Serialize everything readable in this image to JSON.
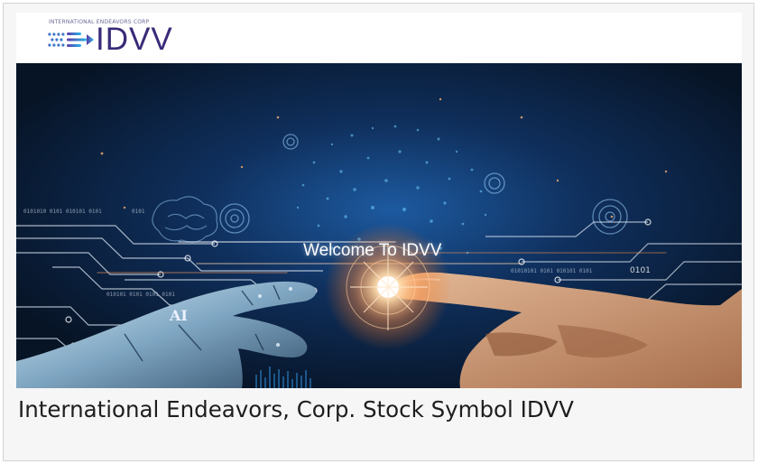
{
  "header": {
    "company_line": "INTERNATIONAL ENDEAVORS CORP",
    "logo_text": "IDVV",
    "logo_icon": "dotted-arrows-icon"
  },
  "hero": {
    "welcome_text": "Welcome To IDVV",
    "ai_label": "AI",
    "image_subject": "robot-hand-touching-human-hand",
    "binary_snippets": [
      "0101",
      "0101",
      "0101",
      "0101",
      "0101"
    ]
  },
  "caption": {
    "text": "International Endeavors, Corp. Stock Symbol IDVV"
  },
  "colors": {
    "logo_purple": "#3a2a78",
    "logo_cyan": "#29b6e8",
    "hero_background": "#0a1a33",
    "glow": "#ffb070"
  }
}
